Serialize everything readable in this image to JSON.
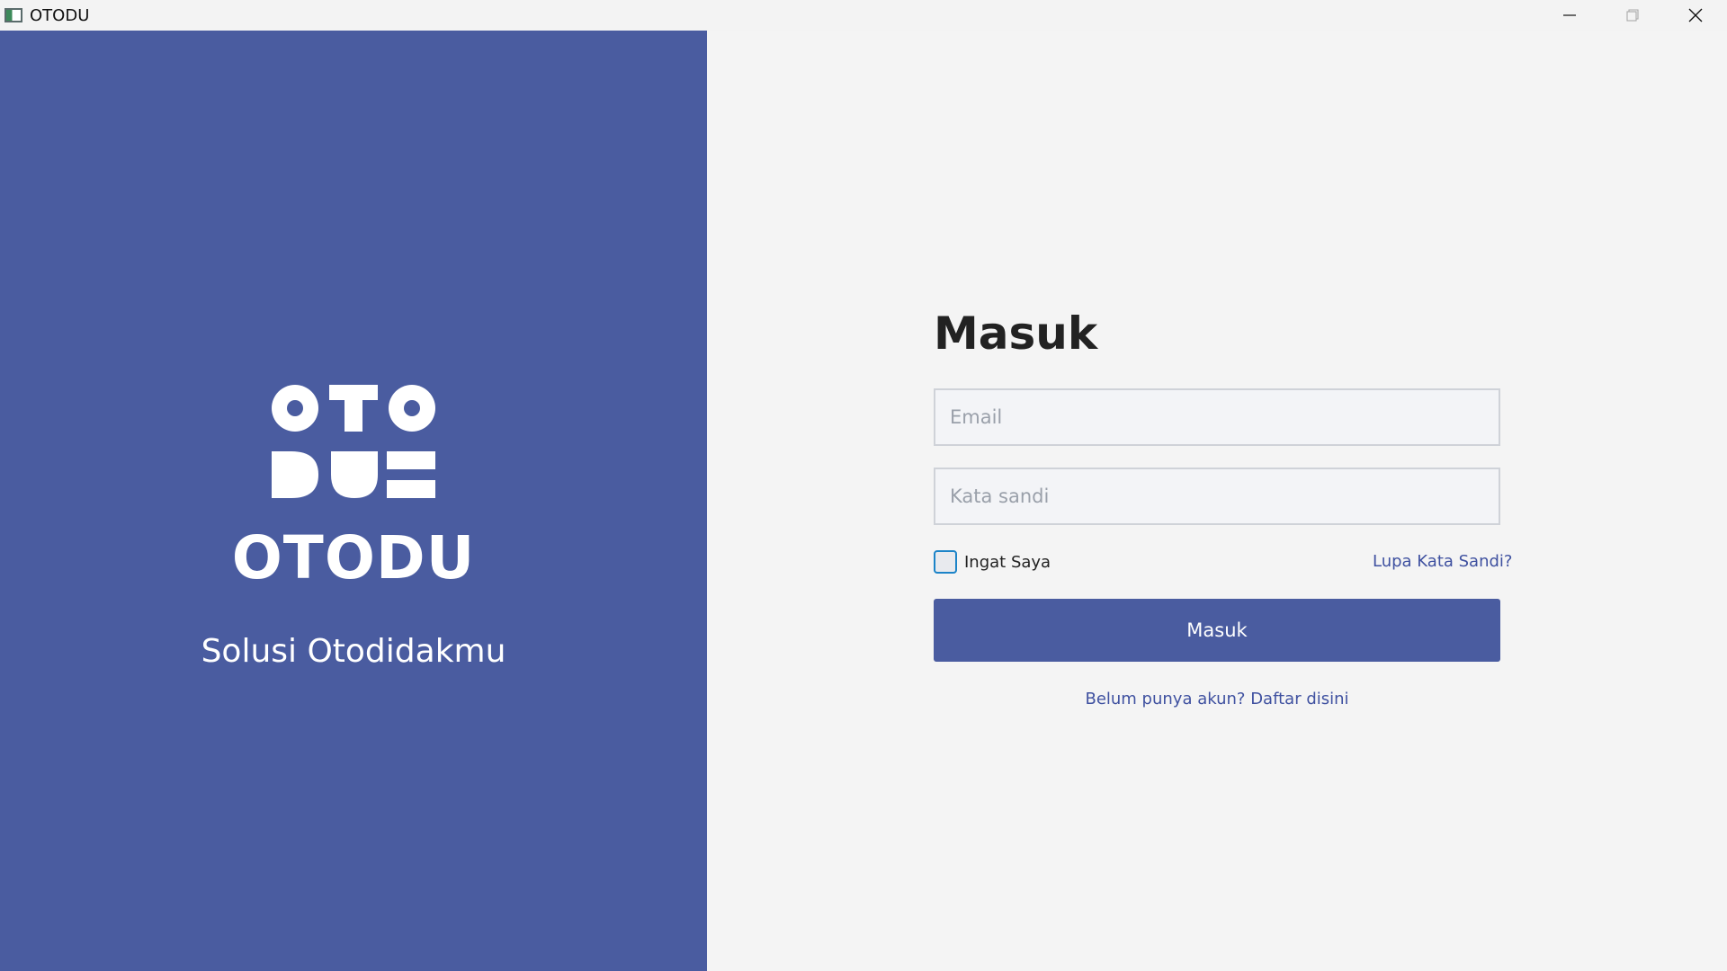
{
  "window": {
    "title": "OTODU",
    "controls": {
      "minimize": "minimize-icon",
      "maximize": "maximize-icon",
      "close": "close-icon"
    }
  },
  "brand": {
    "name": "OTODU",
    "tagline": "Solusi Otodidakmu",
    "logo": "otodu-logo",
    "color": "#4a5ca0"
  },
  "login": {
    "title": "Masuk",
    "email_placeholder": "Email",
    "password_placeholder": "Kata sandi",
    "remember_label": "Ingat Saya",
    "remember_checked": false,
    "forgot_label": "Lupa Kata Sandi?",
    "submit_label": "Masuk",
    "signup_label": "Belum punya akun? Daftar disini"
  }
}
